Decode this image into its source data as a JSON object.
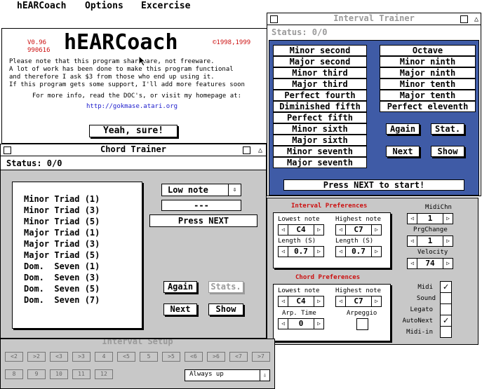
{
  "menubar": {
    "app": "hEARCoach",
    "options": "Options",
    "exercise": "Excercise"
  },
  "about": {
    "version": "V0.96",
    "date": "990616",
    "logo": "hEARCoach",
    "copyright": "©1998,1999",
    "lines": [
      "Please note that this program   shareware, not freeware.",
      "A lot of work has been done to make this program functional",
      "and therefore I ask $3 from those who end up using it.",
      "If this program gets some support, I'll add more features soon",
      "For more info, read the DOC's, or visit my homepage at:"
    ],
    "url": "http://gokmase.atari.org",
    "button": "Yeah, sure!"
  },
  "interval": {
    "title": "Interval Trainer",
    "status": "Status: 0/0",
    "left": [
      "Minor second",
      "Major second",
      "Minor third",
      "Major third",
      "Perfect fourth",
      "Diminished fifth",
      "Perfect fifth",
      "Minor sixth",
      "Major sixth",
      "Minor seventh",
      "Major seventh"
    ],
    "right": [
      "Octave",
      "Minor ninth",
      "Major ninth",
      "Minor tenth",
      "Major tenth",
      "Perfect eleventh"
    ],
    "again": "Again",
    "stat": "Stat.",
    "next": "Next",
    "show": "Show",
    "start": "Press NEXT to start!"
  },
  "chord": {
    "title": "Chord Trainer",
    "status": "Status: 0/0",
    "items": [
      "Minor Triad (1)",
      "Minor Triad (3)",
      "Minor Triad (5)",
      "Major Triad (1)",
      "Major Triad (3)",
      "Major Triad (5)",
      "Dom.  Seven (1)",
      "Dom.  Seven (3)",
      "Dom.  Seven (5)",
      "Dom.  Seven (7)"
    ],
    "low_note": "Low note",
    "dashes": "---",
    "press_next": "Press NEXT",
    "again": "Again",
    "stats": "Stats.",
    "next": "Next",
    "show": "Show"
  },
  "prefs": {
    "interval_title": "Interval Preferences",
    "lowest": "Lowest note",
    "highest": "Highest note",
    "length": "Length (S)",
    "low_val": "C4",
    "high_val": "C7",
    "len1": "0.7",
    "len2": "0.7",
    "chord_title": "Chord Preferences",
    "c_low": "C4",
    "c_high": "C7",
    "arp_time": "Arp. Time",
    "arp_val": "0",
    "arpeggio": "Arpeggio",
    "midichn": "MidiChn",
    "midichn_val": "1",
    "prgchange": "PrgChange",
    "prg_val": "1",
    "velocity": "Velocity",
    "vel_val": "74",
    "checks": [
      {
        "label": "Midi",
        "on": true
      },
      {
        "label": "Sound",
        "on": false
      },
      {
        "label": "Legato",
        "on": false
      },
      {
        "label": "AutoNext",
        "on": true
      },
      {
        "label": "Midi-in",
        "on": false
      }
    ]
  },
  "setup": {
    "title": "Interval Setup",
    "row1": [
      "<2",
      ">2",
      "<3",
      ">3",
      "4",
      "<5",
      "5",
      ">5",
      "<6",
      ">6",
      "<7",
      ">7"
    ],
    "row2": [
      "8",
      "9",
      "10",
      "11",
      "12"
    ],
    "direction": "Always up"
  }
}
